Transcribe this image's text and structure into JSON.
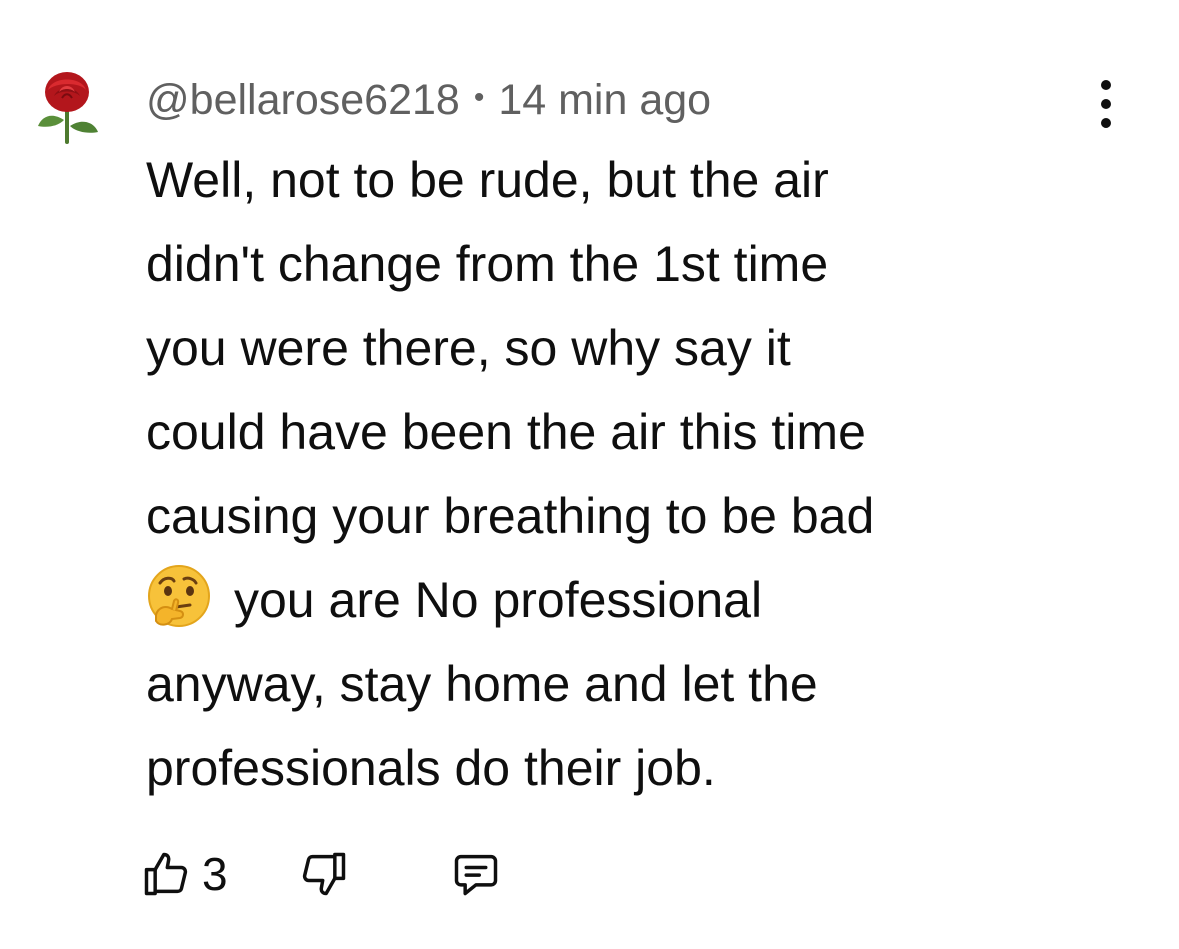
{
  "comment": {
    "avatar_icon": "rose-emoji-icon",
    "author": "@bellarose6218",
    "separator": "•",
    "timestamp": "14 min ago",
    "more_icon": "more-vertical-icon",
    "lines": [
      "Well, not to be rude, but the air",
      "didn't change from the 1st time",
      "you were there, so why say it",
      "could have been the air this time",
      "causing your breathing to be bad",
      "you are No professional",
      "anyway, stay home and let the",
      "professionals do their job."
    ],
    "emoji_icon": "thinking-face-emoji-icon",
    "actions": {
      "like_icon": "thumbs-up-icon",
      "like_count": "3",
      "dislike_icon": "thumbs-down-icon",
      "reply_icon": "reply-comment-icon"
    }
  },
  "colors": {
    "text": "#0f0f0f",
    "meta": "#606060",
    "background": "#ffffff"
  }
}
